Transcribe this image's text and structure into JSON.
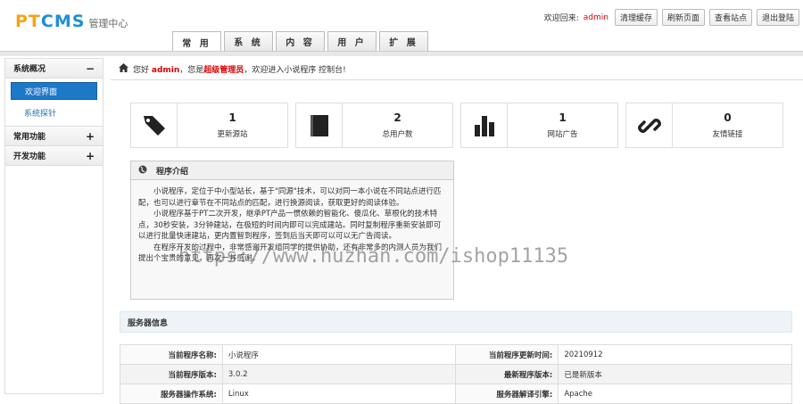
{
  "brand": {
    "logo_pt": "PT",
    "logo_cms": "CMS",
    "subtitle": "管理中心"
  },
  "topbar": {
    "welcome": "欢迎回来:",
    "username": "admin",
    "buttons": [
      "清理缓存",
      "刷新页面",
      "查看站点",
      "退出登陆"
    ]
  },
  "tabs": [
    "常 用",
    "系 统",
    "内 容",
    "用 户",
    "扩 展"
  ],
  "sidebar": {
    "sections": [
      {
        "title": "系统概况",
        "symbol": "−",
        "items": [
          "欢迎界面",
          "系统探针"
        ]
      },
      {
        "title": "常用功能",
        "symbol": "+"
      },
      {
        "title": "开发功能",
        "symbol": "+"
      }
    ]
  },
  "crumb": {
    "hello": "您好",
    "user": "admin",
    "role_prefix": "，您是",
    "role": "超级管理员",
    "suffix": "，欢迎进入小说程序 控制台!"
  },
  "stats": [
    {
      "icon": "tags-icon",
      "num": "1",
      "label": "更新源站"
    },
    {
      "icon": "book-icon",
      "num": "2",
      "label": "总用户数"
    },
    {
      "icon": "bar-chart-icon",
      "num": "1",
      "label": "网站广告"
    },
    {
      "icon": "link-icon",
      "num": "0",
      "label": "友情链接"
    }
  ],
  "intro": {
    "title": "程序介绍",
    "paragraphs": [
      "小说程序，定位于中小型站长，基于\"同源\"技术，可以对同一本小说在不同站点进行匹配，也可以进行章节在不同站点的匹配，进行换源阅读，获取更好的阅读体验。",
      "小说程序基于PT二次开发，继承PT产品一惯依赖的智能化、傻瓜化、草根化的技术特点，30秒安装，3分钟建站，在极短的时间内即可以完成建站。同时复制程序重新安装即可以进行批量快速建站，更内置智到程序，签到后当天即可以可以无广告阅读。",
      "在程序开发的过程中，非常感谢开发组同学的提供协助，还有非常多的内测人员为我们提出个宝贵的意见，再次一并感谢。"
    ]
  },
  "watermark": "https://www.huzhan.com/ishop11135",
  "server": {
    "title": "服务器信息",
    "rows": [
      [
        "当前程序名称:",
        "小说程序",
        "当前程序更新时间:",
        "20210912"
      ],
      [
        "当前程序版本:",
        "3.0.2",
        "最新程序版本:",
        "已是新版本"
      ],
      [
        "服务器操作系统:",
        "Linux",
        "服务器解译引擎:",
        "Apache"
      ]
    ]
  }
}
